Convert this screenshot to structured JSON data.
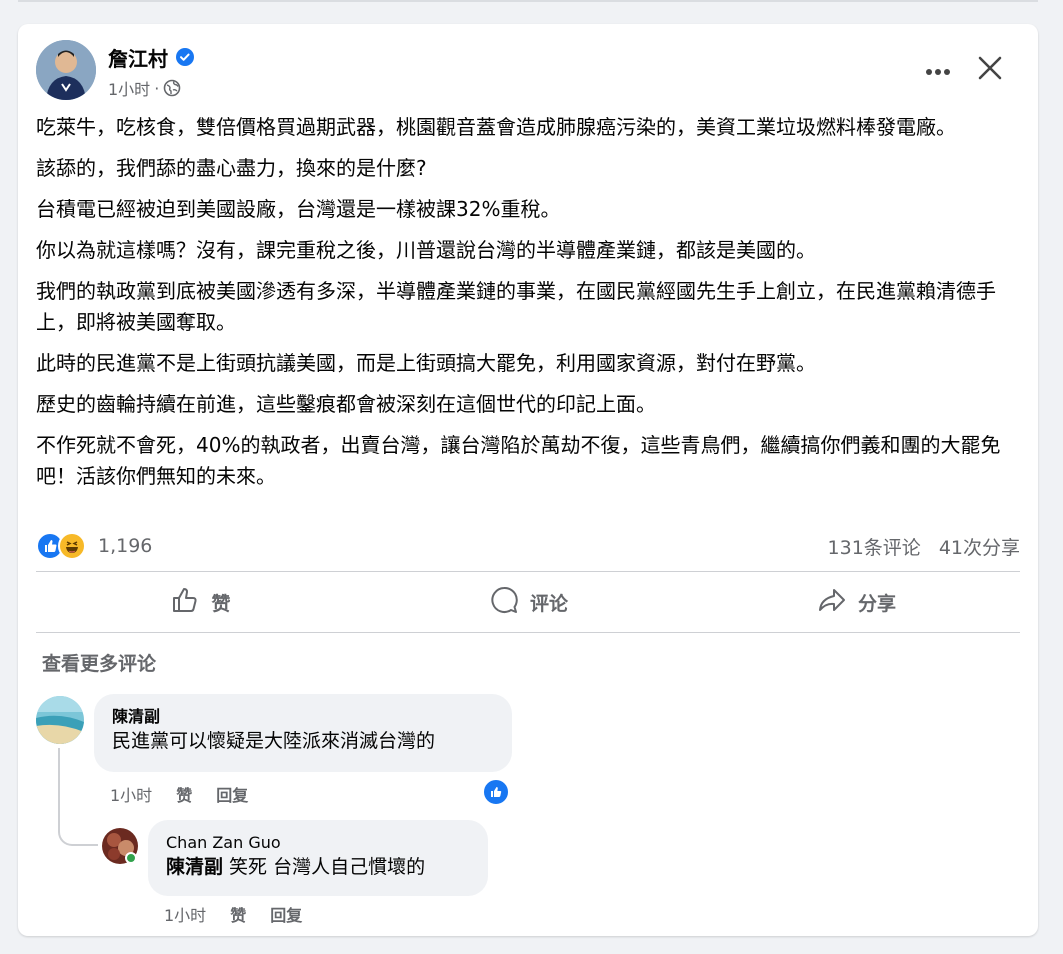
{
  "post": {
    "author": "詹江村",
    "time": "1小时",
    "meta_separator": "·",
    "paragraphs": [
      "吃萊牛，吃核食，雙倍價格買過期武器，桃園觀音蓋會造成肺腺癌污染的，美資工業垃圾燃料棒發電廠。",
      "該舔的，我們舔的盡心盡力，換來的是什麼?",
      "台積電已經被迫到美國設廠，台灣還是一樣被課32%重稅。",
      "你以為就這樣嗎？沒有，課完重稅之後，川普還說台灣的半導體產業鏈，都該是美國的。",
      "我們的執政黨到底被美國滲透有多深，半導體產業鏈的事業，在國民黨經國先生手上創立，在民進黨賴清德手上，即將被美國奪取。",
      "此時的民進黨不是上街頭抗議美國，而是上街頭搞大罷免，利用國家資源，對付在野黨。",
      "歷史的齒輪持續在前進，這些鑿痕都會被深刻在這個世代的印記上面。",
      "不作死就不會死，40%的執政者，出賣台灣，讓台灣陷於萬劫不復，這些青鳥們，繼續搞你們義和團的大罷免吧！活該你們無知的未來。"
    ],
    "reaction_count": "1,196",
    "comment_count": "131条评论",
    "share_count": "41次分享"
  },
  "actions": {
    "like": "赞",
    "comment": "评论",
    "share": "分享"
  },
  "more_comments": "查看更多评论",
  "comments": [
    {
      "author": "陳清副",
      "text": "民進黨可以懷疑是大陸派來消滅台灣的",
      "time": "1小时",
      "like": "赞",
      "reply": "回复"
    },
    {
      "author": "Chan Zan Guo",
      "mention": "陳清副",
      "text": " 笑死 台灣人自己慣壞的",
      "time": "1小时",
      "like": "赞",
      "reply": "回复"
    }
  ],
  "colors": {
    "brand_blue": "#1877f2",
    "secondary_text": "#65676b",
    "bubble_bg": "#f0f2f5",
    "online": "#31a24c"
  },
  "icons": [
    "verified-icon",
    "globe-icon",
    "more-icon",
    "close-icon",
    "like-icon",
    "comment-icon",
    "share-icon",
    "like-reaction-icon",
    "haha-reaction-icon"
  ]
}
